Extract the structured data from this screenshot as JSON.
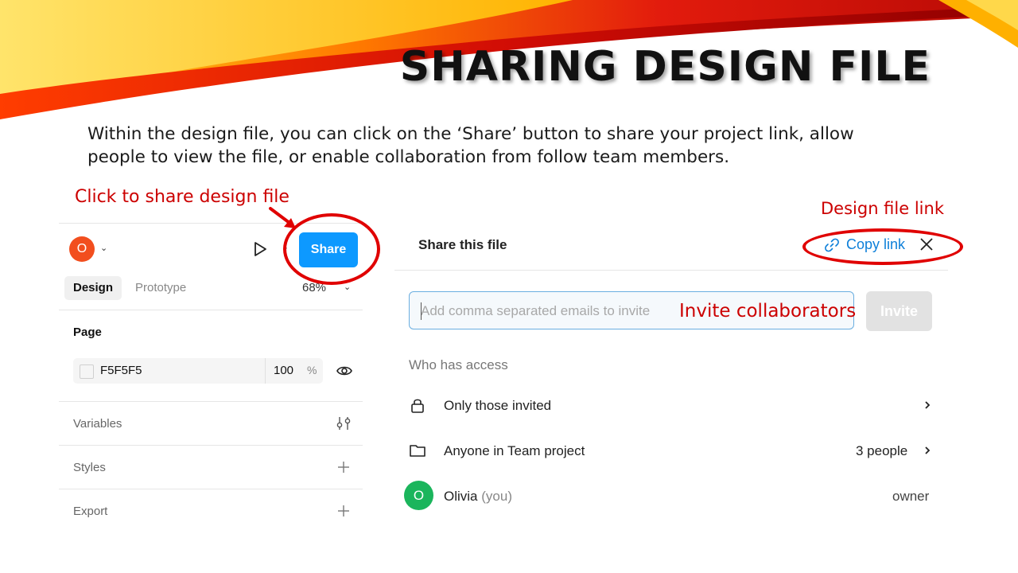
{
  "slide": {
    "title": "SHARING DESIGN FILE",
    "intro": "Within the design file, you can click on the ‘Share’ button to share your project link, allow people to view the file, or enable collaboration from follow team members."
  },
  "annotations": {
    "share": "Click to share design file",
    "link": "Design file link",
    "invite": "Invite collaborators"
  },
  "left_panel": {
    "avatar_initial": "O",
    "share_button": "Share",
    "tabs": [
      "Design",
      "Prototype"
    ],
    "zoom": "68%",
    "page_section": "Page",
    "page_color": "F5F5F5",
    "page_opacity": "100",
    "opacity_unit": "%",
    "sections": [
      "Variables",
      "Styles",
      "Export"
    ]
  },
  "share_panel": {
    "title": "Share this file",
    "copy_link": "Copy link",
    "email_placeholder": "Add comma separated emails to invite",
    "invite_button": "Invite",
    "who_has_access": "Who has access",
    "access_rows": [
      {
        "label": "Only those invited",
        "icon": "lock-icon"
      },
      {
        "label": "Anyone in Team project",
        "icon": "folder-icon",
        "count": "3 people"
      }
    ],
    "user": {
      "initial": "O",
      "name": "Olivia",
      "you": "(you)",
      "role": "owner"
    }
  },
  "colors": {
    "annotation": "#cc0000",
    "share_button": "#0d99ff",
    "link": "#0d7fd9",
    "avatar_owner": "#1bb55c",
    "avatar_file": "#f24e1e"
  }
}
